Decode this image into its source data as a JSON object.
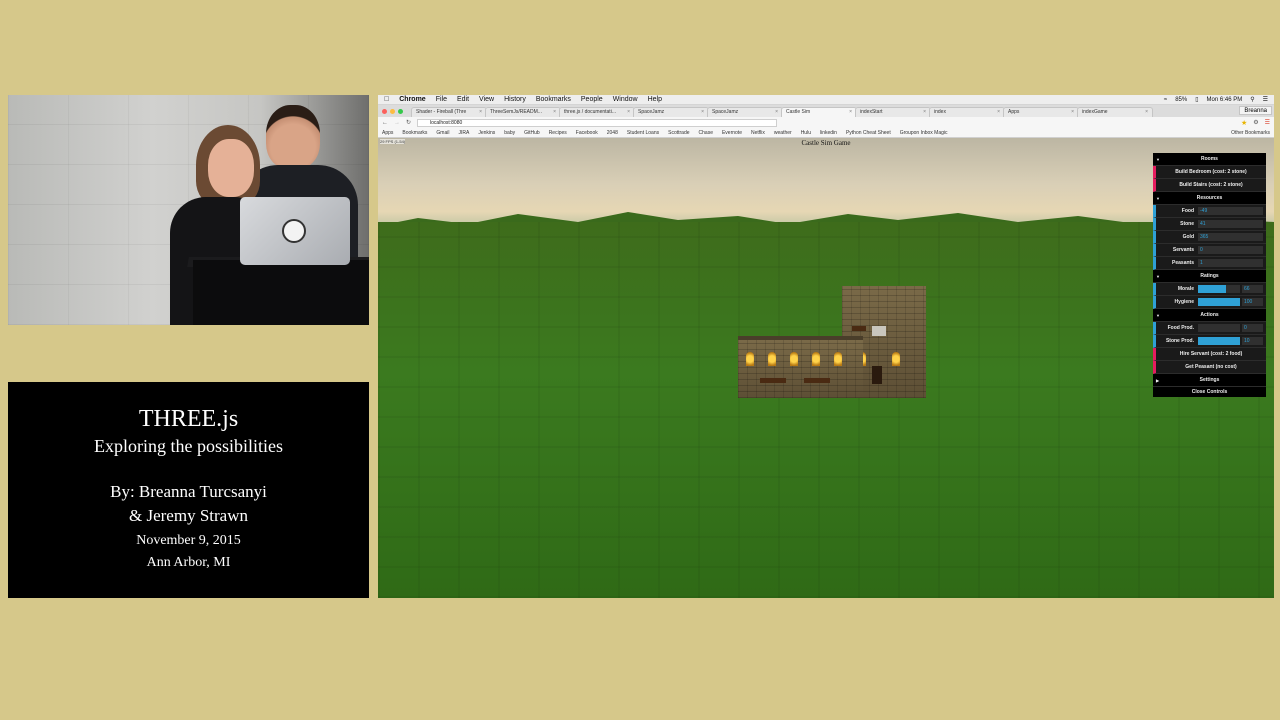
{
  "slide": {
    "title": "THREE.js",
    "subtitle": "Exploring the possibilities",
    "authors_line1": "By: Breanna Turcsanyi",
    "authors_line2": "& Jeremy Strawn",
    "date": "November 9, 2015",
    "location": "Ann Arbor, MI"
  },
  "menubar": {
    "app": "Chrome",
    "items": [
      "File",
      "Edit",
      "View",
      "History",
      "Bookmarks",
      "People",
      "Window",
      "Help"
    ],
    "battery": "85%",
    "clock": "Mon 6:46 PM"
  },
  "tabs": [
    {
      "label": "Shader - Fireball (Thre"
    },
    {
      "label": "ThreeSemJs/READM..."
    },
    {
      "label": "three.js / documentati..."
    },
    {
      "label": "SpaceJamz"
    },
    {
      "label": "SpaceJamz"
    },
    {
      "label": "Castle Sim",
      "active": true
    },
    {
      "label": "indexStart"
    },
    {
      "label": "index"
    },
    {
      "label": "Apps"
    },
    {
      "label": "indexGame"
    }
  ],
  "profile": "Breanna",
  "address": {
    "url": "localhost:8080"
  },
  "bookmarks": [
    "Apps",
    "Bookmarks",
    "Gmail",
    "JIRA",
    "Jenkins",
    "baby",
    "GitHub",
    "Recipes",
    "Facebook",
    "2048",
    "Student Loans",
    "Scottrade",
    "Chase",
    "Evernote",
    "Netflix",
    "weather",
    "Hulu",
    "linkedin",
    "Python Cheat Sheet",
    "Groupon Inbox Magic"
  ],
  "bookmarks_other": "Other Bookmarks",
  "game": {
    "title": "Castle Sim Game",
    "fps": "29 FPS (1-54)"
  },
  "gui": {
    "rooms_folder": "Rooms",
    "build_bedroom": "Build Bedroom (cost: 2 stone)",
    "build_stairs": "Build Stairs (cost: 2 stone)",
    "resources_folder": "Resources",
    "food_label": "Food",
    "food_value": "-49",
    "stone_label": "Stone",
    "stone_value": "41",
    "gold_label": "Gold",
    "gold_value": "365",
    "servants_label": "Servants",
    "servants_value": "0",
    "peasants_label": "Peasants",
    "peasants_value": "1",
    "ratings_folder": "Ratings",
    "morale_label": "Morale",
    "morale_value": "66",
    "morale_fraction": 0.66,
    "hygiene_label": "Hygiene",
    "hygiene_value": "100",
    "hygiene_fraction": 1.0,
    "actions_folder": "Actions",
    "food_prod_label": "Food Prod.",
    "food_prod_value": "0",
    "food_prod_fraction": 0.0,
    "stone_prod_label": "Stone Prod.",
    "stone_prod_value": "10",
    "stone_prod_fraction": 1.0,
    "hire_servant": "Hire Servant (cost: 2 food)",
    "get_peasant": "Get Peasant (no cost)",
    "settings_folder": "Settings",
    "close_controls": "Close Controls"
  },
  "colors": {
    "background": "#d6c88a",
    "gui_button_accent": "#e61d5f",
    "gui_number_accent": "#2fa1d6"
  }
}
